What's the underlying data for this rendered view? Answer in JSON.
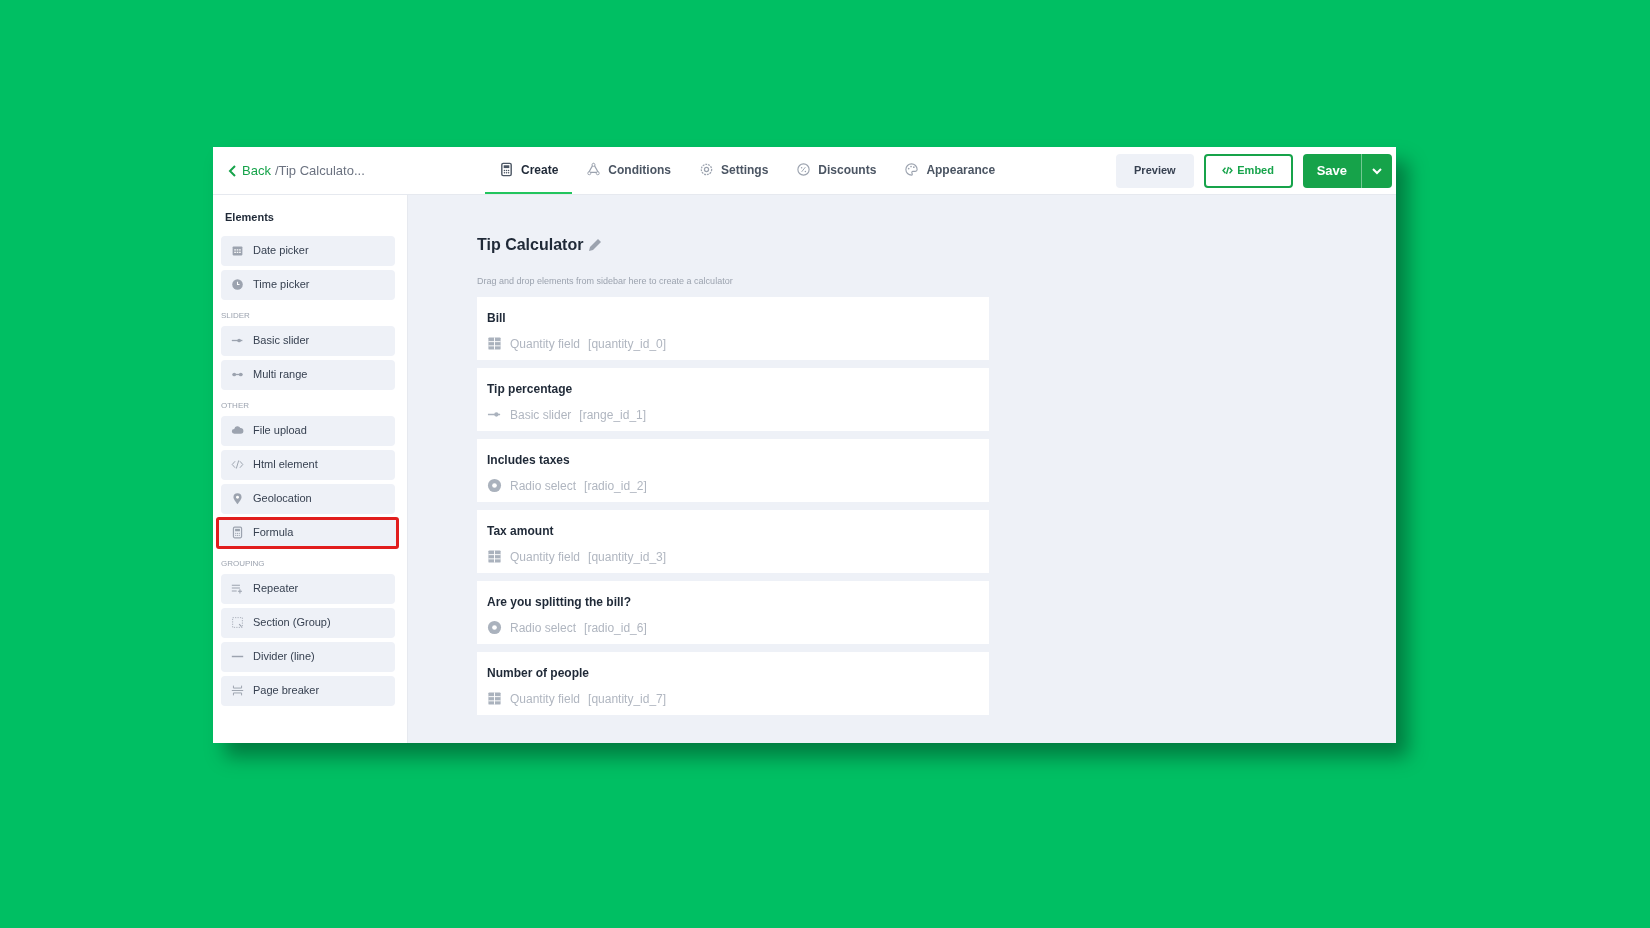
{
  "header": {
    "back": "Back",
    "breadcrumb": "/Tip Calculato...",
    "tabs": [
      {
        "label": "Create",
        "kind": "calculator",
        "selected": true
      },
      {
        "label": "Conditions",
        "kind": "conditions",
        "selected": false
      },
      {
        "label": "Settings",
        "kind": "gear",
        "selected": false
      },
      {
        "label": "Discounts",
        "kind": "percent",
        "selected": false
      },
      {
        "label": "Appearance",
        "kind": "palette",
        "selected": false
      }
    ],
    "buttons": {
      "preview": "Preview",
      "embed": "Embed",
      "save": "Save"
    }
  },
  "sidebar": {
    "title": "Elements",
    "groups": [
      {
        "items": [
          {
            "label": "Date picker",
            "kind": "calendar",
            "highlighted": false
          },
          {
            "label": "Time picker",
            "kind": "clock",
            "highlighted": false
          }
        ]
      },
      {
        "heading": "SLIDER",
        "items": [
          {
            "label": "Basic slider",
            "kind": "slider",
            "highlighted": false
          },
          {
            "label": "Multi range",
            "kind": "range",
            "highlighted": false
          }
        ]
      },
      {
        "heading": "OTHER",
        "items": [
          {
            "label": "File upload",
            "kind": "cloud",
            "highlighted": false
          },
          {
            "label": "Html element",
            "kind": "code",
            "highlighted": false
          },
          {
            "label": "Geolocation",
            "kind": "pin",
            "highlighted": false
          },
          {
            "label": "Formula",
            "kind": "calculator",
            "highlighted": true
          }
        ]
      },
      {
        "heading": "GROUPING",
        "items": [
          {
            "label": "Repeater",
            "kind": "repeater",
            "highlighted": false
          },
          {
            "label": "Section (Group)",
            "kind": "section",
            "highlighted": false
          },
          {
            "label": "Divider (line)",
            "kind": "line",
            "highlighted": false
          },
          {
            "label": "Page breaker",
            "kind": "pagebreak",
            "highlighted": false
          }
        ]
      }
    ]
  },
  "canvas": {
    "title": "Tip Calculator",
    "hint": "Drag and drop elements from sidebar here to create a calculator",
    "fields": [
      {
        "label": "Bill",
        "kind": "quantity",
        "type": "Quantity field",
        "id": "[quantity_id_0]"
      },
      {
        "label": "Tip percentage",
        "kind": "slider",
        "type": "Basic slider",
        "id": "[range_id_1]"
      },
      {
        "label": "Includes taxes",
        "kind": "radio",
        "type": "Radio select",
        "id": "[radio_id_2]"
      },
      {
        "label": "Tax amount",
        "kind": "quantity",
        "type": "Quantity field",
        "id": "[quantity_id_3]"
      },
      {
        "label": "Are you splitting the bill?",
        "kind": "radio",
        "type": "Radio select",
        "id": "[radio_id_6]"
      },
      {
        "label": "Number of people",
        "kind": "quantity",
        "type": "Quantity field",
        "id": "[quantity_id_7]"
      }
    ]
  }
}
